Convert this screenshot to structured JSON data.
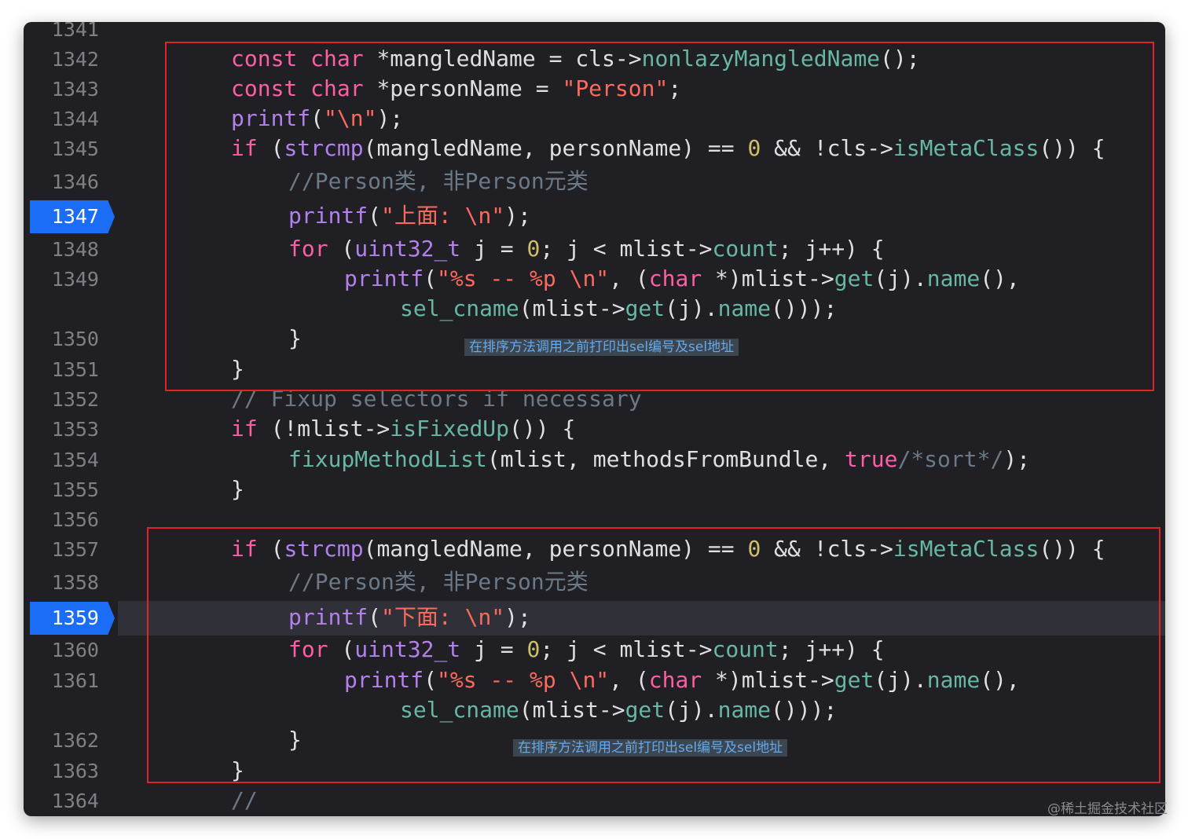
{
  "editor": {
    "line_numbers": [
      "1341",
      "1342",
      "1343",
      "1344",
      "1345",
      "1346",
      "1347",
      "1348",
      "1349",
      "1350",
      "1351",
      "1352",
      "1353",
      "1354",
      "1355",
      "1356",
      "1357",
      "1358",
      "1359",
      "1360",
      "1361",
      "1362",
      "1363",
      "1364"
    ],
    "breakpoint_lines": [
      "1347",
      "1359"
    ],
    "current_line": "1359",
    "colors": {
      "background": "#1f1f24",
      "keyword": "#fc5fa3",
      "function": "#67b7a4",
      "string": "#fc6a5d",
      "number": "#d0bf69",
      "comment": "#6c7986",
      "printf": "#b281eb",
      "breakpoint": "#1b6df5",
      "annotation_box": "#e0232b"
    },
    "code": [
      [
        "const",
        " ",
        "char",
        " *mangledName = cls->",
        "nonlazyMangledName",
        "();"
      ],
      [
        "const",
        " ",
        "char",
        " *personName = ",
        "\"Person\"",
        ";"
      ],
      [
        "printf",
        "(",
        "\"\\n\"",
        ");"
      ],
      [
        "if",
        " (",
        "strcmp",
        "(mangledName, personName) == ",
        "0",
        " && !cls->",
        "isMetaClass",
        "()) {"
      ],
      [
        "//Person类, 非Person元类"
      ],
      [
        "printf",
        "(",
        "\"上面: \\n\"",
        ");"
      ],
      [
        "for",
        " (",
        "uint32_t",
        " j = ",
        "0",
        "; j < mlist->",
        "count",
        "; j++) {"
      ],
      [
        "printf",
        "(",
        "\"%s -- %p \\n\"",
        ", (",
        "char",
        " *)mlist->",
        "get",
        "(j).",
        "name",
        "(),"
      ],
      [
        "sel_cname",
        "(mlist->",
        "get",
        "(j).",
        "name",
        "()));"
      ],
      [
        "}"
      ],
      [
        "}"
      ],
      [
        "// Fixup selectors if necessary"
      ],
      [
        "if",
        " (!mlist->",
        "isFixedUp",
        "()) {"
      ],
      [
        "fixupMethodList",
        "(mlist, methodsFromBundle, ",
        "true",
        "/*sort*/",
        ");"
      ],
      [
        "}"
      ],
      [
        "if",
        " (",
        "strcmp",
        "(mangledName, personName) == ",
        "0",
        " && !cls->",
        "isMetaClass",
        "()) {"
      ],
      [
        "//Person类, 非Person元类"
      ],
      [
        "printf",
        "(",
        "\"下面: \\n\"",
        ");"
      ],
      [
        "for",
        " (",
        "uint32_t",
        " j = ",
        "0",
        "; j < mlist->",
        "count",
        "; j++) {"
      ],
      [
        "printf",
        "(",
        "\"%s -- %p \\n\"",
        ", (",
        "char",
        " *)mlist->",
        "get",
        "(j).",
        "name",
        "(),"
      ],
      [
        "sel_cname",
        "(mlist->",
        "get",
        "(j).",
        "name",
        "()));"
      ],
      [
        "}"
      ],
      [
        "}"
      ],
      [
        "//"
      ]
    ]
  },
  "annotations": {
    "upper_note": "在排序方法调用之前打印出sel编号及sel地址",
    "lower_note": "在排序方法调用之前打印出sel编号及sel地址"
  },
  "watermark": "@稀土掘金技术社区"
}
